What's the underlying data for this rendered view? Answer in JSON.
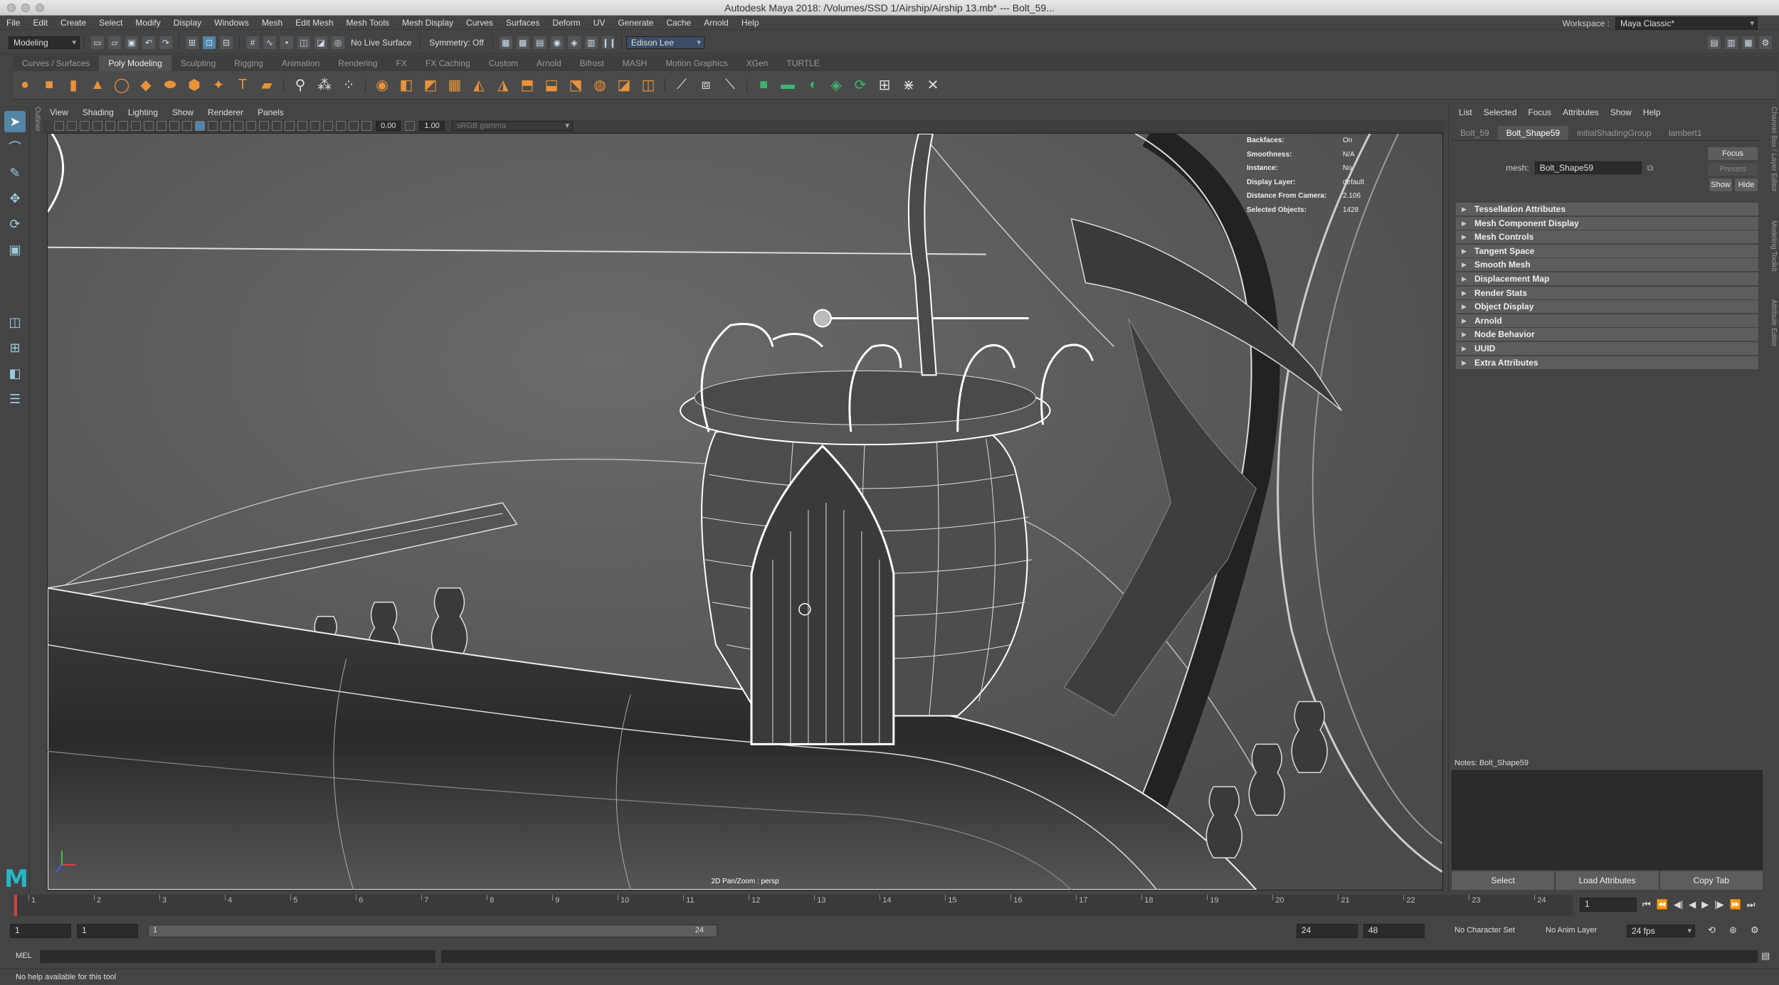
{
  "window": {
    "title": "Autodesk Maya 2018: /Volumes/SSD 1/Airship/Airship 13.mb*   ---   Bolt_59..."
  },
  "menus": [
    "File",
    "Edit",
    "Create",
    "Select",
    "Modify",
    "Display",
    "Windows",
    "Mesh",
    "Edit Mesh",
    "Mesh Tools",
    "Mesh Display",
    "Curves",
    "Surfaces",
    "Deform",
    "UV",
    "Generate",
    "Cache",
    "Arnold",
    "Help"
  ],
  "workspace": {
    "label": "Workspace :",
    "value": "Maya Classic*"
  },
  "status": {
    "mode": "Modeling",
    "live_surface": "No Live Surface",
    "symmetry": "Symmetry: Off",
    "user": "Edison Lee"
  },
  "shelf_tabs": [
    "Curves / Surfaces",
    "Poly Modeling",
    "Sculpting",
    "Rigging",
    "Animation",
    "Rendering",
    "FX",
    "FX Caching",
    "Custom",
    "Arnold",
    "Bifrost",
    "MASH",
    "Motion Graphics",
    "XGen",
    "TURTLE"
  ],
  "shelf_active": "Poly Modeling",
  "viewport_menus": [
    "View",
    "Shading",
    "Lighting",
    "Show",
    "Renderer",
    "Panels"
  ],
  "viewport_toolbar": {
    "exposure": "0.00",
    "gamma": "1.00",
    "color_space": "sRGB gamma"
  },
  "hud": [
    {
      "key": "Backfaces:",
      "value": "On"
    },
    {
      "key": "Smoothness:",
      "value": "N/A"
    },
    {
      "key": "Instance:",
      "value": "No"
    },
    {
      "key": "Display Layer:",
      "value": "default"
    },
    {
      "key": "Distance From Camera:",
      "value": "2.106"
    },
    {
      "key": "Selected Objects:",
      "value": "1428"
    }
  ],
  "camera_label": "2D Pan/Zoom : persp",
  "attr_editor": {
    "menu": [
      "List",
      "Selected",
      "Focus",
      "Attributes",
      "Show",
      "Help"
    ],
    "tabs": [
      "Bolt_59",
      "Bolt_Shape59",
      "initialShadingGroup",
      "lambert1"
    ],
    "active_tab": "Bolt_Shape59",
    "mesh_label": "mesh:",
    "mesh_value": "Bolt_Shape59",
    "focus_btn": "Focus",
    "presets_btn": "Presets",
    "show_btn": "Show",
    "hide_btn": "Hide",
    "sections": [
      "Tessellation Attributes",
      "Mesh Component Display",
      "Mesh Controls",
      "Tangent Space",
      "Smooth Mesh",
      "Displacement Map",
      "Render Stats",
      "Object Display",
      "Arnold",
      "Node Behavior",
      "UUID",
      "Extra Attributes"
    ],
    "notes_label": "Notes:  Bolt_Shape59",
    "buttons": [
      "Select",
      "Load Attributes",
      "Copy Tab"
    ]
  },
  "side_tabs": [
    "Channel Box / Layer Editor",
    "Modeling Toolkit",
    "Attribute Editor"
  ],
  "timeline": {
    "ticks": [
      "1",
      "2",
      "3",
      "4",
      "5",
      "6",
      "7",
      "8",
      "9",
      "10",
      "11",
      "12",
      "13",
      "14",
      "15",
      "16",
      "17",
      "18",
      "19",
      "20",
      "21",
      "22",
      "23",
      "24"
    ],
    "current_frame": "1"
  },
  "range": {
    "start": "1",
    "inner_start": "1",
    "range_start": "1",
    "range_end": "24",
    "end": "24",
    "anim_end": "48",
    "character_set": "No Character Set",
    "anim_layer": "No Anim Layer",
    "fps": "24 fps"
  },
  "command": {
    "lang": "MEL"
  },
  "help_text": "No help available for this tool"
}
